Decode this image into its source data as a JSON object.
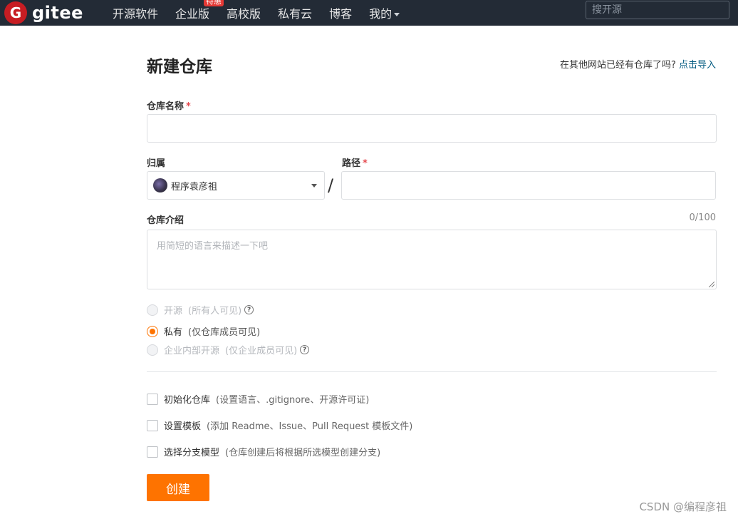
{
  "header": {
    "logo_mark": "G",
    "logo_text": "gitee",
    "nav": [
      {
        "label": "开源软件"
      },
      {
        "label": "企业版",
        "badge": "特惠"
      },
      {
        "label": "高校版"
      },
      {
        "label": "私有云"
      },
      {
        "label": "博客"
      },
      {
        "label": "我的"
      }
    ],
    "search_placeholder": "搜开源"
  },
  "page": {
    "title": "新建仓库",
    "import_prompt": "在其他网站已经有仓库了吗?",
    "import_link": "点击导入"
  },
  "form": {
    "repo_name_label": "仓库名称",
    "owner_label": "归属",
    "owner_value": "程序袁彦祖",
    "path_label": "路径",
    "path_separator": "/",
    "required_mark": "*",
    "desc_label": "仓库介绍",
    "desc_counter": "0/100",
    "desc_placeholder": "用简短的语言来描述一下吧",
    "visibility": [
      {
        "label": "开源",
        "hint": "(所有人可见)",
        "selected": false,
        "disabled": true,
        "has_help": true
      },
      {
        "label": "私有",
        "hint": "(仅仓库成员可见)",
        "selected": true,
        "disabled": false,
        "has_help": false
      },
      {
        "label": "企业内部开源",
        "hint": "(仅企业成员可见)",
        "selected": false,
        "disabled": true,
        "has_help": true
      }
    ],
    "options": [
      {
        "label": "初始化仓库",
        "hint": "(设置语言、.gitignore、开源许可证)",
        "checked": false
      },
      {
        "label": "设置模板",
        "hint": "(添加 Readme、Issue、Pull Request 模板文件)",
        "checked": false
      },
      {
        "label": "选择分支模型",
        "hint": "(仓库创建后将根据所选模型创建分支)",
        "checked": false
      }
    ],
    "submit_label": "创建"
  },
  "watermark": "CSDN @编程彦祖",
  "colors": {
    "accent": "#fe7300",
    "nav_bg": "#232b36",
    "logo_red": "#c71d23",
    "link": "#005980",
    "required": "#e5484d"
  }
}
